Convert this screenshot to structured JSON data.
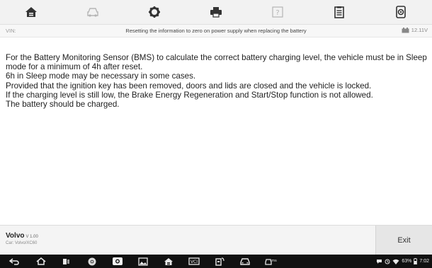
{
  "toolbar": {
    "icons": [
      "home-icon",
      "vehicle-icon",
      "settings-icon",
      "print-icon",
      "help-icon",
      "data-log-icon",
      "screenshot-icon"
    ]
  },
  "infobar": {
    "vin_label": "VIN:",
    "title": "Resetting the information to zero on power supply when replacing the battery",
    "voltage": "12.11V"
  },
  "content": {
    "lines": [
      "For the Battery Monitoring Sensor (BMS) to calculate the correct battery charging level, the vehicle must be in Sleep mode for a minimum of 4h after reset.",
      "6h in Sleep mode may be necessary in some cases.",
      "Provided that the ignition key has been removed, doors and lids are closed and the vehicle is locked.",
      "If the charging level is still low, the Brake Energy Regeneration and Start/Stop function is not allowed.",
      "The battery should be charged."
    ]
  },
  "footer": {
    "brand": "Volvo",
    "version": "V 1.00",
    "car": "Car: Volvo/XC60",
    "exit_label": "Exit"
  },
  "navbar": {
    "icons": [
      "back-icon",
      "android-home-icon",
      "recent-apps-icon",
      "chrome-icon",
      "camera-icon",
      "gallery-icon",
      "maxisys-home-icon",
      "vci-icon",
      "vehicle-connect-icon",
      "car-icon",
      "tpms-icon"
    ]
  },
  "status": {
    "battery_percent": "63%",
    "time": "7:02"
  },
  "colors": {
    "toolbar_bg": "#f2f2f2",
    "icon_dark": "#333333",
    "icon_light": "#b5b5b5",
    "navbar_bg": "#111111"
  }
}
